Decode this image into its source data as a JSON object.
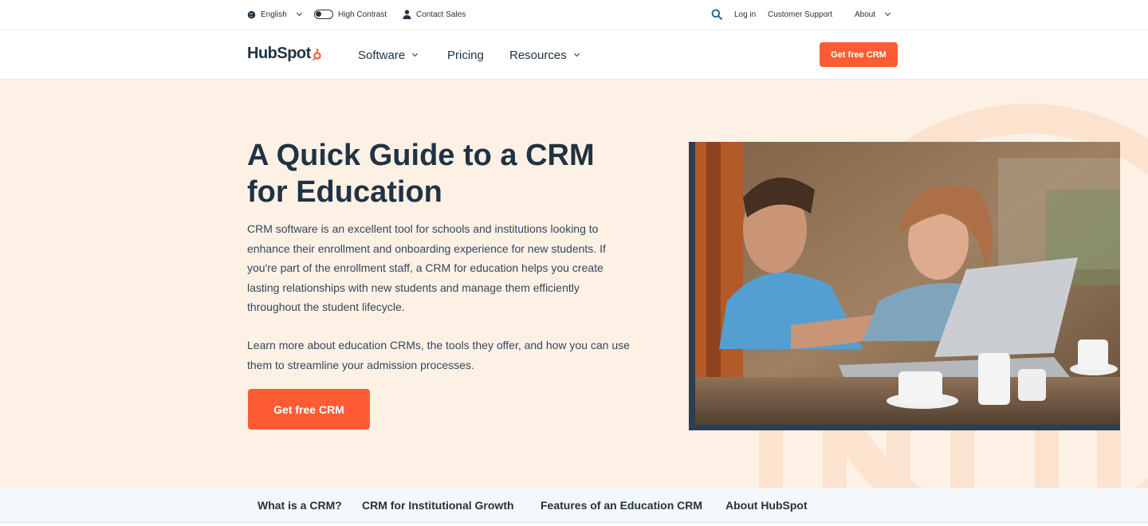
{
  "utility": {
    "language": "English",
    "high_contrast": "High Contrast",
    "contact_sales": "Contact Sales",
    "login": "Log in",
    "customer_support": "Customer Support",
    "about": "About"
  },
  "nav": {
    "logo_text": "HubSpot",
    "software": "Software",
    "pricing": "Pricing",
    "resources": "Resources",
    "cta": "Get free CRM"
  },
  "hero": {
    "title": "A Quick Guide to a CRM for Education",
    "paragraph1": "CRM software is an excellent tool for schools and institutions looking to enhance their enrollment and onboarding experience for new students. If you're part of the enrollment staff, a CRM for education helps you create lasting relationships with new students and manage them efficiently throughout the student lifecycle.",
    "paragraph2": "Learn more about education CRMs, the tools they offer, and how you can use them to streamline your admission processes.",
    "cta": "Get free CRM"
  },
  "tabs": [
    "What is a CRM?",
    "CRM for Institutional Growth",
    "Features of an Education CRM",
    "About HubSpot"
  ],
  "colors": {
    "accent": "#ff5c35",
    "hero_bg": "#fdf1e6",
    "text": "#213343"
  }
}
